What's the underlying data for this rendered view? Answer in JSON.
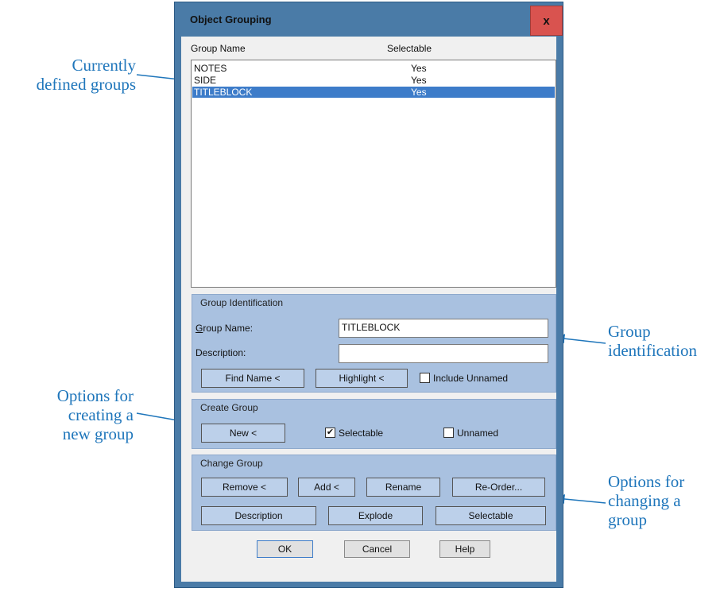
{
  "dialog": {
    "title": "Object Grouping",
    "close_label": "x",
    "list_headers": [
      "Group Name",
      "Selectable"
    ],
    "groups": [
      {
        "name": "NOTES",
        "selectable": "Yes"
      },
      {
        "name": "SIDE",
        "selectable": "Yes"
      },
      {
        "name": "TITLEBLOCK",
        "selectable": "Yes"
      }
    ],
    "group_identification": {
      "title": "Group Identification",
      "group_name_label": "Group Name:",
      "group_name_value": "TITLEBLOCK",
      "description_label": "Description:",
      "description_value": "",
      "find_name_button": "Find Name <",
      "highlight_button": "Highlight <",
      "include_unnamed_label": "Include Unnamed",
      "include_unnamed_checked": false
    },
    "create_group": {
      "title": "Create Group",
      "new_button": "New <",
      "selectable_label": "Selectable",
      "selectable_checked": true,
      "unnamed_label": "Unnamed",
      "unnamed_checked": false
    },
    "change_group": {
      "title": "Change Group",
      "remove_button": "Remove <",
      "add_button": "Add <",
      "rename_button": "Rename",
      "reorder_button": "Re-Order...",
      "description_button": "Description",
      "explode_button": "Explode",
      "selectable_button": "Selectable"
    },
    "ok_button": "OK",
    "cancel_button": "Cancel",
    "help_button": "Help"
  },
  "annotations": {
    "currently_defined": [
      "Currently",
      "defined groups"
    ],
    "group_identification": [
      "Group",
      "identification"
    ],
    "creating_new": [
      "Options for",
      "creating a",
      "new group"
    ],
    "changing": [
      "Options for",
      "changing a",
      "group"
    ]
  },
  "colors": {
    "annotation": "#1f76bb",
    "selection": "#3d7cc9",
    "group_panel": "#a9c1e0",
    "close_button": "#d9534f"
  }
}
